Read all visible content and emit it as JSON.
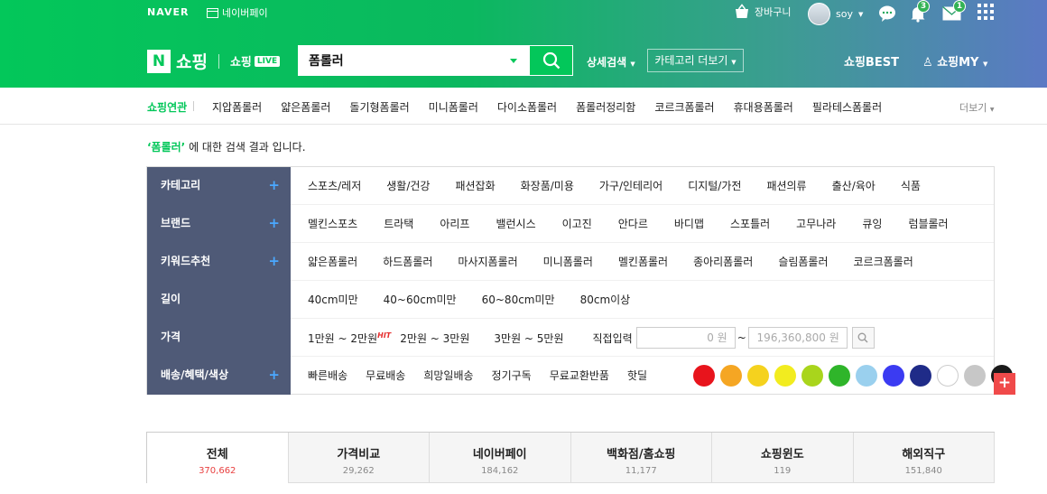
{
  "topbar": {
    "naver": "NAVER",
    "naverpay": "네이버페이",
    "cart": "장바구니",
    "user": "soy",
    "alarm_count": "3",
    "mail_count": "1"
  },
  "header": {
    "logo_n": "N",
    "logo_shop": "쇼핑",
    "live_label": "쇼핑",
    "live_tag": "LIVE",
    "search_value": "폼롤러",
    "detail_search": "상세검색",
    "category_more": "카테고리 더보기",
    "best": "쇼핑BEST",
    "my": "쇼핑MY"
  },
  "related": {
    "label": "쇼핑연관",
    "items": [
      "지압폼롤러",
      "얇은폼롤러",
      "돌기형폼롤러",
      "미니폼롤러",
      "다이소폼롤러",
      "폼롤러정리함",
      "코르크폼롤러",
      "휴대용폼롤러",
      "필라테스폼롤러"
    ],
    "more": "더보기"
  },
  "result": {
    "query": "‘폼롤러’",
    "text": " 에 대한 검색 결과 입니다."
  },
  "filters": [
    {
      "label": "카테고리",
      "items": [
        "스포츠/레저",
        "생활/건강",
        "패션잡화",
        "화장품/미용",
        "가구/인테리어",
        "디지털/가전",
        "패션의류",
        "출산/육아",
        "식품"
      ]
    },
    {
      "label": "브랜드",
      "items": [
        "멜킨스포츠",
        "트라택",
        "아리프",
        "밸런시스",
        "이고진",
        "안다르",
        "바디맵",
        "스포틀러",
        "고무나라",
        "큐잉",
        "럼블롤러"
      ]
    },
    {
      "label": "키워드추천",
      "items": [
        "얇은폼롤러",
        "하드폼롤러",
        "마사지폼롤러",
        "미니폼롤러",
        "멜킨폼롤러",
        "종아리폼롤러",
        "슬림폼롤러",
        "코르크폼롤러"
      ]
    },
    {
      "label": "길이",
      "items": [
        "40cm미만",
        "40~60cm미만",
        "60~80cm미만",
        "80cm이상"
      ]
    },
    {
      "label": "가격",
      "items": [
        "1만원 ~ 2만원",
        "2만원 ~ 3만원",
        "3만원 ~ 5만원"
      ],
      "hit": "HIT",
      "direct": "직접입력",
      "min": "0 원",
      "tilde": "~",
      "max": "196,360,800 원"
    },
    {
      "label": "배송/혜택/색상",
      "items": [
        "빠른배송",
        "무료배송",
        "희망일배송",
        "정기구독",
        "무료교환반품",
        "핫딜"
      ]
    }
  ],
  "colors": [
    "#e8141c",
    "#f5a623",
    "#f5d21e",
    "#f2ec1f",
    "#a9d51c",
    "#2fb52a",
    "#9ad0ee",
    "#3b3bf2",
    "#1f2b88",
    "#ffffff",
    "#c7c7c7",
    "#1a1a1a"
  ],
  "tabs": [
    {
      "label": "전체",
      "count": "370,662"
    },
    {
      "label": "가격비교",
      "count": "29,262"
    },
    {
      "label": "네이버페이",
      "count": "184,162"
    },
    {
      "label": "백화점/홈쇼핑",
      "count": "11,177"
    },
    {
      "label": "쇼핑윈도",
      "count": "119"
    },
    {
      "label": "해외직구",
      "count": "151,840"
    }
  ]
}
